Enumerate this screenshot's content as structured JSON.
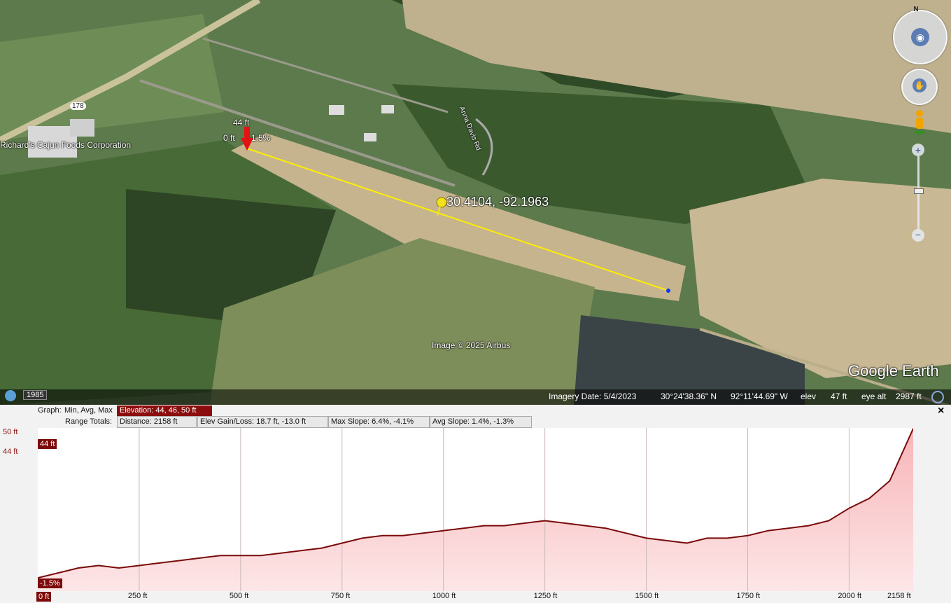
{
  "map": {
    "place_label": "Richard's Cajun Foods Corporation",
    "road_shield": "178",
    "road_name": "Anna Davis Rd",
    "pin_label": "30.4104, -92.1963",
    "path_start": {
      "elev": "44 ft",
      "dist": "0 ft",
      "slope": "-1.5%"
    },
    "watermark_copyright": "Image © 2025 Airbus",
    "brand": "Google Earth",
    "history_year": "1985",
    "compass_north": "N",
    "path_color": "#ffee00"
  },
  "status_bar": {
    "imagery_date": "Imagery Date: 5/4/2023",
    "lat": "30°24'38.36\" N",
    "lon": "92°11'44.69\" W",
    "elev_label": "elev",
    "elev_value": "47 ft",
    "eye_alt_label": "eye alt",
    "eye_alt_value": "2987 ft"
  },
  "profile": {
    "close_symbol": "×",
    "graph_label": "Graph:",
    "graph_mode": "Min, Avg, Max",
    "elevation_summary": "Elevation: 44, 46, 50 ft",
    "range_totals_label": "Range Totals:",
    "distance": "Distance: 2158 ft",
    "gain_loss": "Elev Gain/Loss: 18.7 ft, -13.0 ft",
    "max_slope": "Max Slope: 6.4%, -4.1%",
    "avg_slope": "Avg Slope: 1.4%, -1.3%",
    "y_max_label": "50 ft",
    "y_min_label": "44 ft",
    "cursor_elev": "44 ft",
    "cursor_slope": "-1.5%",
    "cursor_dist": "0 ft",
    "x_ticks": [
      "250 ft",
      "500 ft",
      "750 ft",
      "1000 ft",
      "1250 ft",
      "1500 ft",
      "1750 ft",
      "2000 ft"
    ],
    "x_end": "2158 ft",
    "fill_color": "#f7b5b8",
    "line_color": "#7a0a0a"
  },
  "chart_data": {
    "type": "area",
    "xlabel": "",
    "ylabel": "",
    "xlim": [
      0,
      2158
    ],
    "ylim": [
      43.5,
      50
    ],
    "x": [
      0,
      50,
      100,
      150,
      200,
      250,
      300,
      350,
      400,
      450,
      500,
      550,
      600,
      650,
      700,
      750,
      800,
      850,
      900,
      950,
      1000,
      1050,
      1100,
      1150,
      1200,
      1250,
      1300,
      1350,
      1400,
      1450,
      1500,
      1550,
      1600,
      1650,
      1700,
      1750,
      1800,
      1850,
      1900,
      1950,
      2000,
      2050,
      2100,
      2158
    ],
    "y": [
      44.0,
      44.2,
      44.4,
      44.5,
      44.4,
      44.5,
      44.6,
      44.7,
      44.8,
      44.9,
      44.9,
      44.9,
      45.0,
      45.1,
      45.2,
      45.4,
      45.6,
      45.7,
      45.7,
      45.8,
      45.9,
      46.0,
      46.1,
      46.1,
      46.2,
      46.3,
      46.2,
      46.1,
      46.0,
      45.8,
      45.6,
      45.5,
      45.4,
      45.6,
      45.6,
      45.7,
      45.9,
      46.0,
      46.1,
      46.3,
      46.8,
      47.2,
      47.9,
      50.0
    ]
  }
}
